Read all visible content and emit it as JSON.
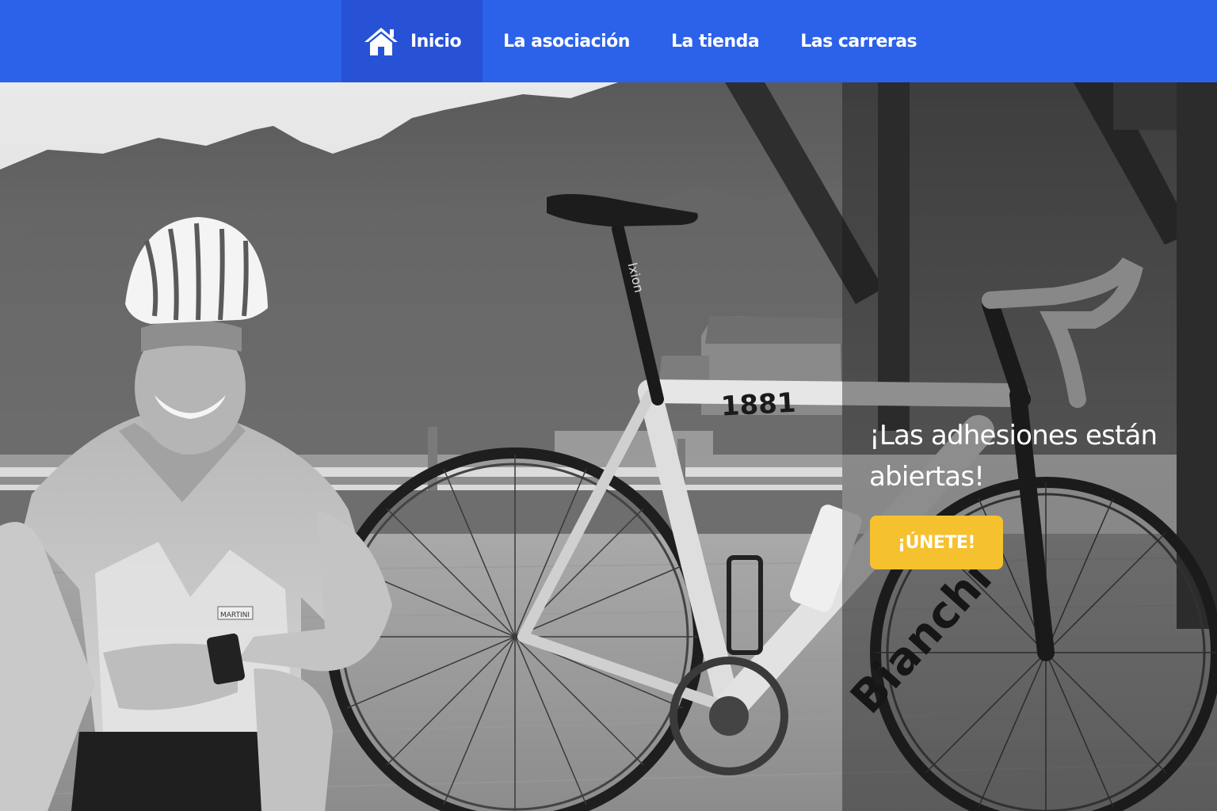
{
  "nav": {
    "items": [
      {
        "label": "Inicio",
        "icon": "home-icon",
        "active": true
      },
      {
        "label": "La asociación",
        "active": false
      },
      {
        "label": "La tienda",
        "active": false
      },
      {
        "label": "Las carreras",
        "active": false
      }
    ]
  },
  "hero": {
    "promo_title": "¡Las adhesiones están abiertas!",
    "join_button_label": "¡ÚNETE!",
    "image_labels": {
      "frame_text": "1881",
      "down_tube_brand": "Bianchi",
      "seatpost_text": "Ixion",
      "jersey_patch": "MARTINI"
    }
  },
  "colors": {
    "nav_background": "#2c62ea",
    "nav_active_background": "#2752d6",
    "button_background": "#f6c12e",
    "text_on_dark": "#ffffff"
  }
}
